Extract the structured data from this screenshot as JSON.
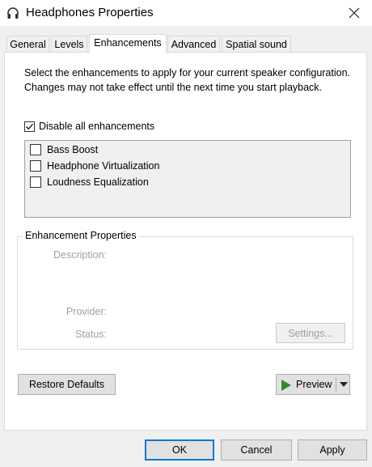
{
  "window": {
    "title": "Headphones Properties"
  },
  "tabs": [
    {
      "label": "General",
      "active": false
    },
    {
      "label": "Levels",
      "active": false
    },
    {
      "label": "Enhancements",
      "active": true
    },
    {
      "label": "Advanced",
      "active": false
    },
    {
      "label": "Spatial sound",
      "active": false
    }
  ],
  "enhancements": {
    "intro": "Select the enhancements to apply for your current speaker configuration. Changes may not take effect until the next time you start playback.",
    "disable_all_label": "Disable all enhancements",
    "disable_all_checked": true,
    "items": [
      {
        "label": "Bass Boost",
        "checked": false
      },
      {
        "label": "Headphone Virtualization",
        "checked": false
      },
      {
        "label": "Loudness Equalization",
        "checked": false
      }
    ]
  },
  "properties": {
    "group_title": "Enhancement Properties",
    "description_label": "Description:",
    "provider_label": "Provider:",
    "status_label": "Status:",
    "settings_button": "Settings..."
  },
  "buttons": {
    "restore_defaults": "Restore Defaults",
    "preview": "Preview",
    "ok": "OK",
    "cancel": "Cancel",
    "apply": "Apply"
  },
  "colors": {
    "accent": "#0078d7",
    "play_icon": "#2e8b2e",
    "disabled_text": "#a0a0a0"
  }
}
